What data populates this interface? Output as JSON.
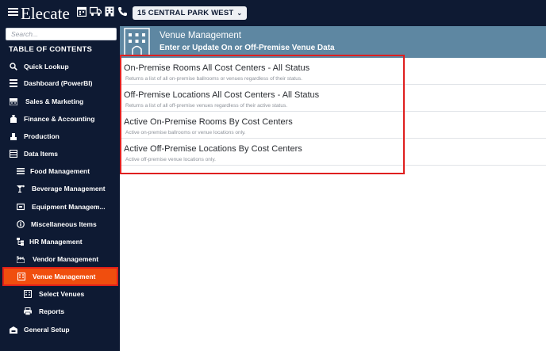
{
  "app": {
    "brand": "Elecate",
    "location": "15 CENTRAL PARK WEST"
  },
  "sidebar": {
    "search_placeholder": "Search...",
    "toc_title": "TABLE OF CONTENTS",
    "items": [
      {
        "label": "Quick Lookup",
        "icon": "search-icon"
      },
      {
        "label": "Dashboard (PowerBI)",
        "icon": "dashboard-icon"
      },
      {
        "label": "Sales & Marketing",
        "icon": "cash-register-icon"
      },
      {
        "label": "Finance & Accounting",
        "icon": "finance-icon"
      },
      {
        "label": "Production",
        "icon": "production-icon"
      },
      {
        "label": "Data Items",
        "icon": "data-icon"
      },
      {
        "label": "Food Management",
        "icon": "list-icon"
      },
      {
        "label": "Beverage Management",
        "icon": "cocktail-icon"
      },
      {
        "label": "Equipment Managem...",
        "icon": "equipment-icon"
      },
      {
        "label": "Miscellaneous Items",
        "icon": "info-icon"
      },
      {
        "label": "HR Management",
        "icon": "sitemap-icon"
      },
      {
        "label": "Vendor Management",
        "icon": "industry-icon"
      },
      {
        "label": "Venue Management",
        "icon": "building-icon",
        "active": true
      },
      {
        "label": "Select Venues",
        "icon": "building-icon"
      },
      {
        "label": "Reports",
        "icon": "print-icon"
      },
      {
        "label": "General Setup",
        "icon": "setup-icon"
      }
    ]
  },
  "header": {
    "title": "Venue Management",
    "subtitle": "Enter or Update On or Off-Premise Venue Data"
  },
  "reports": [
    {
      "title": "On-Premise Rooms All Cost Centers - All Status",
      "description": "Returns a list of all on-premise ballrooms or venues regardless of their status."
    },
    {
      "title": "Off-Premise Locations All Cost Centers - All Status",
      "description": "Returns a list of all off-premise venues regardless of their active status."
    },
    {
      "title": "Active On-Premise Rooms By Cost Centers",
      "description": "Active on-premise ballrooms or venue locations only."
    },
    {
      "title": "Active Off-Premise Locations By Cost Centers",
      "description": "Active off-premise venue locations only."
    }
  ],
  "colors": {
    "sidebar_bg": "#0e1a33",
    "active_item": "#f04e0e",
    "header_bg": "#5e87a2",
    "highlight_border": "#df1f1f"
  }
}
